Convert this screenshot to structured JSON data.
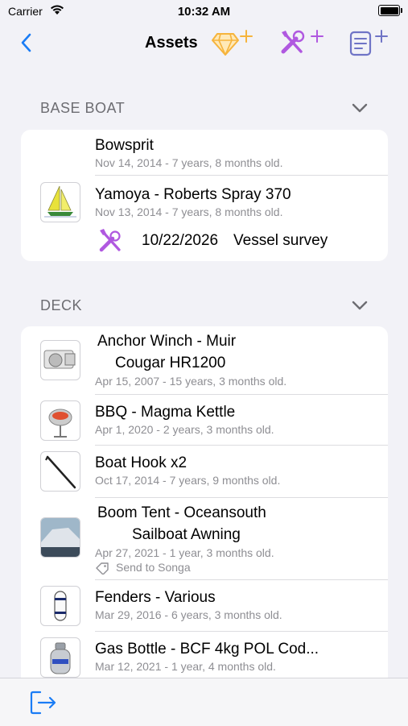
{
  "status_bar": {
    "carrier": "Carrier",
    "time": "10:32 AM"
  },
  "nav": {
    "title": "Assets",
    "back_icon": "chevron-left-icon",
    "add_asset_icon": "diamond-plus-icon",
    "add_maintenance_icon": "tools-plus-icon",
    "add_document_icon": "list-plus-icon",
    "accent": "#1a7cf5",
    "icon_accent": "#b058e0",
    "diamond_color": "#f6b43c"
  },
  "sections": [
    {
      "title": "BASE BOAT",
      "items": [
        {
          "name": "Bowsprit",
          "subtitle": "Nov 14, 2014 - 7 years, 8 months old."
        },
        {
          "name": "Yamoya - Roberts Spray 370",
          "subtitle": "Nov 13, 2014 - 7 years, 8 months old.",
          "reminder_date": "10/22/2026",
          "reminder_label": "Vessel survey"
        }
      ]
    },
    {
      "title": "DECK",
      "items": [
        {
          "name_line1": "Anchor Winch - Muir",
          "name_line2": "Cougar HR1200",
          "subtitle": "Apr 15, 2007 - 15 years, 3 months old."
        },
        {
          "name": "BBQ - Magma Kettle",
          "subtitle": "Apr 1, 2020 - 2 years, 3 months old."
        },
        {
          "name": "Boat Hook x2",
          "subtitle": "Oct 17, 2014 - 7 years, 9 months old."
        },
        {
          "name_line1": "Boom Tent - Oceansouth",
          "name_line2": "Sailboat Awning",
          "subtitle": "Apr 27, 2021 - 1 year, 3 months old.",
          "tag": "Send to Songa"
        },
        {
          "name": "Fenders - Various",
          "subtitle": "Mar 29, 2016 - 6 years, 3 months old."
        },
        {
          "name": "Gas Bottle - BCF 4kg POL Cod...",
          "subtitle": "Mar 12, 2021 - 1 year, 4 months old."
        }
      ]
    }
  ],
  "toolbar": {
    "export_icon": "export-icon"
  }
}
